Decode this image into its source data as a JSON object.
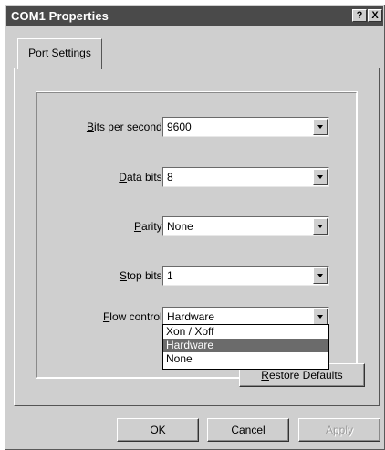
{
  "window": {
    "title": "COM1 Properties",
    "help_button": "?",
    "close_button": "X"
  },
  "tabs": [
    {
      "label": "Port Settings"
    }
  ],
  "fields": [
    {
      "label_u": "B",
      "label_rest": "its per second:",
      "value": "9600"
    },
    {
      "label_u": "D",
      "label_rest": "ata bits:",
      "value": "8"
    },
    {
      "label_u": "P",
      "label_rest": "arity:",
      "value": "None"
    },
    {
      "label_u": "S",
      "label_rest": "top bits:",
      "value": "1"
    },
    {
      "label_u": "F",
      "label_rest": "low control:",
      "value": "Hardware"
    }
  ],
  "flow_control_options": [
    "Xon / Xoff",
    "Hardware",
    "None"
  ],
  "flow_control_selected": "Hardware",
  "restore_button": {
    "label_u": "R",
    "label_rest": "estore Defaults"
  },
  "footer_buttons": {
    "ok": "OK",
    "cancel": "Cancel",
    "apply": "Apply"
  },
  "colors": {
    "titlebar": "#4a4a4a",
    "face": "#cfcfcf",
    "selection": "#6b6b6b"
  }
}
